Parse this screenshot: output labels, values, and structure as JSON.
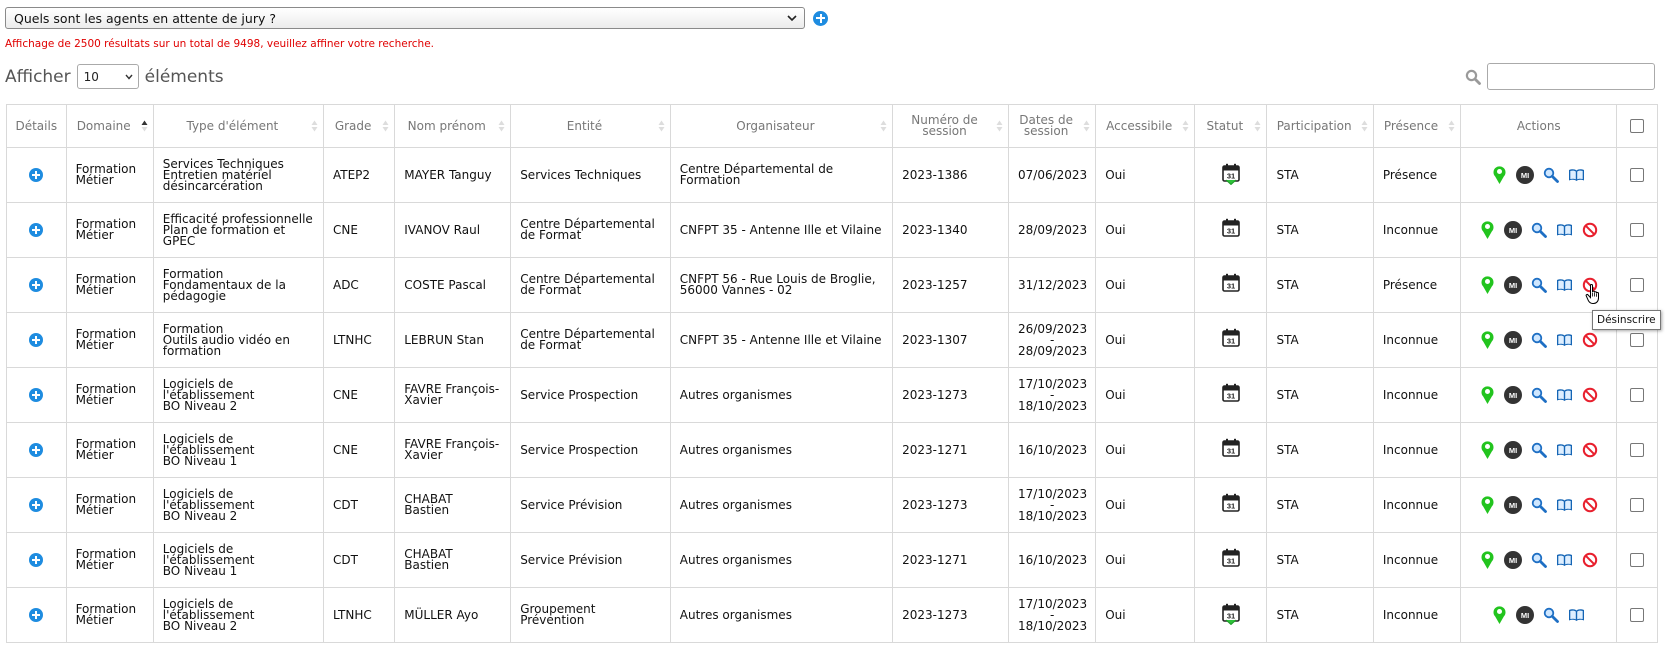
{
  "query": {
    "selected": "Quels sont les agents en attente de jury ?"
  },
  "warning": "Affichage de 2500 résultats sur un total de 9498, veuillez affiner votre recherche.",
  "length": {
    "prefix": "Afficher",
    "value": "10",
    "suffix": "éléments"
  },
  "search": {
    "value": ""
  },
  "columns": [
    "Détails",
    "Domaine",
    "Type d'élément",
    "Grade",
    "Nom prénom",
    "Entité",
    "Organisateur",
    "Numéro de session",
    "Dates de session",
    "Accessibile",
    "Statut",
    "Participation",
    "Présence",
    "Actions"
  ],
  "rows": [
    {
      "domaine": [
        "Formation",
        "Métier"
      ],
      "type": [
        "Services Techniques",
        "Entretien matériel",
        "désincarcération"
      ],
      "grade": "ATEP2",
      "nom": [
        "MAYER Tanguy"
      ],
      "entite": [
        "Services Techniques"
      ],
      "organisateur": [
        "Centre Départemental de",
        "Formation"
      ],
      "session": "2023-1386",
      "dates": [
        "07/06/2023"
      ],
      "accessible": "Oui",
      "statut": "calendar-check",
      "participation": "STA",
      "presence": "Présence",
      "actions": [
        "pin",
        "mi",
        "search",
        "book"
      ]
    },
    {
      "domaine": [
        "Formation",
        "Métier"
      ],
      "type": [
        "Efficacité professionnelle",
        "Plan de formation et",
        "GPEC"
      ],
      "grade": "CNE",
      "nom": [
        "IVANOV Raul"
      ],
      "entite": [
        "Centre Départemental",
        "de Format"
      ],
      "organisateur": [
        "CNFPT 35 - Antenne Ille et Vilaine"
      ],
      "session": "2023-1340",
      "dates": [
        "28/09/2023"
      ],
      "accessible": "Oui",
      "statut": "calendar",
      "participation": "STA",
      "presence": "Inconnue",
      "actions": [
        "pin",
        "mi",
        "search",
        "book",
        "ban"
      ]
    },
    {
      "domaine": [
        "Formation",
        "Métier"
      ],
      "type": [
        "Formation",
        "Fondamentaux de la",
        "pédagogie"
      ],
      "grade": "ADC",
      "nom": [
        "COSTE Pascal"
      ],
      "entite": [
        "Centre Départemental",
        "de Format"
      ],
      "organisateur": [
        "CNFPT 56 - Rue Louis de Broglie,",
        "56000 Vannes - 02"
      ],
      "session": "2023-1257",
      "dates": [
        "31/12/2023"
      ],
      "accessible": "Oui",
      "statut": "calendar",
      "participation": "STA",
      "presence": "Présence",
      "actions": [
        "pin",
        "mi",
        "search",
        "book",
        "ban"
      ]
    },
    {
      "domaine": [
        "Formation",
        "Métier"
      ],
      "type": [
        "Formation",
        "Outils audio vidéo en",
        "formation"
      ],
      "grade": "LTNHC",
      "nom": [
        "LEBRUN Stan"
      ],
      "entite": [
        "Centre Départemental",
        "de Format"
      ],
      "organisateur": [
        "CNFPT 35 - Antenne Ille et Vilaine"
      ],
      "session": "2023-1307",
      "dates": [
        "26/09/2023",
        "-",
        "28/09/2023"
      ],
      "accessible": "Oui",
      "statut": "calendar",
      "participation": "STA",
      "presence": "Inconnue",
      "actions": [
        "pin",
        "mi",
        "search",
        "book",
        "ban"
      ]
    },
    {
      "domaine": [
        "Formation",
        "Métier"
      ],
      "type": [
        "Logiciels de",
        "l'établissement",
        "BO Niveau 2"
      ],
      "grade": "CNE",
      "nom": [
        "FAVRE François-",
        "Xavier"
      ],
      "entite": [
        "Service Prospection"
      ],
      "organisateur": [
        "Autres organismes"
      ],
      "session": "2023-1273",
      "dates": [
        "17/10/2023",
        "-",
        "18/10/2023"
      ],
      "accessible": "Oui",
      "statut": "calendar",
      "participation": "STA",
      "presence": "Inconnue",
      "actions": [
        "pin",
        "mi",
        "search",
        "book",
        "ban"
      ]
    },
    {
      "domaine": [
        "Formation",
        "Métier"
      ],
      "type": [
        "Logiciels de",
        "l'établissement",
        "BO Niveau 1"
      ],
      "grade": "CNE",
      "nom": [
        "FAVRE François-",
        "Xavier"
      ],
      "entite": [
        "Service Prospection"
      ],
      "organisateur": [
        "Autres organismes"
      ],
      "session": "2023-1271",
      "dates": [
        "16/10/2023"
      ],
      "accessible": "Oui",
      "statut": "calendar",
      "participation": "STA",
      "presence": "Inconnue",
      "actions": [
        "pin",
        "mi",
        "search",
        "book",
        "ban"
      ]
    },
    {
      "domaine": [
        "Formation",
        "Métier"
      ],
      "type": [
        "Logiciels de",
        "l'établissement",
        "BO Niveau 2"
      ],
      "grade": "CDT",
      "nom": [
        "CHABAT Bastien"
      ],
      "entite": [
        "Service Prévision"
      ],
      "organisateur": [
        "Autres organismes"
      ],
      "session": "2023-1273",
      "dates": [
        "17/10/2023",
        "-",
        "18/10/2023"
      ],
      "accessible": "Oui",
      "statut": "calendar",
      "participation": "STA",
      "presence": "Inconnue",
      "actions": [
        "pin",
        "mi",
        "search",
        "book",
        "ban"
      ]
    },
    {
      "domaine": [
        "Formation",
        "Métier"
      ],
      "type": [
        "Logiciels de",
        "l'établissement",
        "BO Niveau 1"
      ],
      "grade": "CDT",
      "nom": [
        "CHABAT Bastien"
      ],
      "entite": [
        "Service Prévision"
      ],
      "organisateur": [
        "Autres organismes"
      ],
      "session": "2023-1271",
      "dates": [
        "16/10/2023"
      ],
      "accessible": "Oui",
      "statut": "calendar",
      "participation": "STA",
      "presence": "Inconnue",
      "actions": [
        "pin",
        "mi",
        "search",
        "book",
        "ban"
      ]
    },
    {
      "domaine": [
        "Formation",
        "Métier"
      ],
      "type": [
        "Logiciels de",
        "l'établissement",
        "BO Niveau 2"
      ],
      "grade": "LTNHC",
      "nom": [
        "MÜLLER Ayo"
      ],
      "entite": [
        "Groupement Prévention"
      ],
      "organisateur": [
        "Autres organismes"
      ],
      "session": "2023-1273",
      "dates": [
        "17/10/2023",
        "-",
        "18/10/2023"
      ],
      "accessible": "Oui",
      "statut": "calendar-check",
      "participation": "STA",
      "presence": "Inconnue",
      "actions": [
        "pin",
        "mi",
        "search",
        "book"
      ]
    }
  ],
  "mi_label": "MI",
  "tooltip": "Désinscrire",
  "colors": {
    "accent": "#1e8ce0",
    "pin": "#22c41e",
    "danger": "#e8202e",
    "warning_text": "#e00000"
  }
}
